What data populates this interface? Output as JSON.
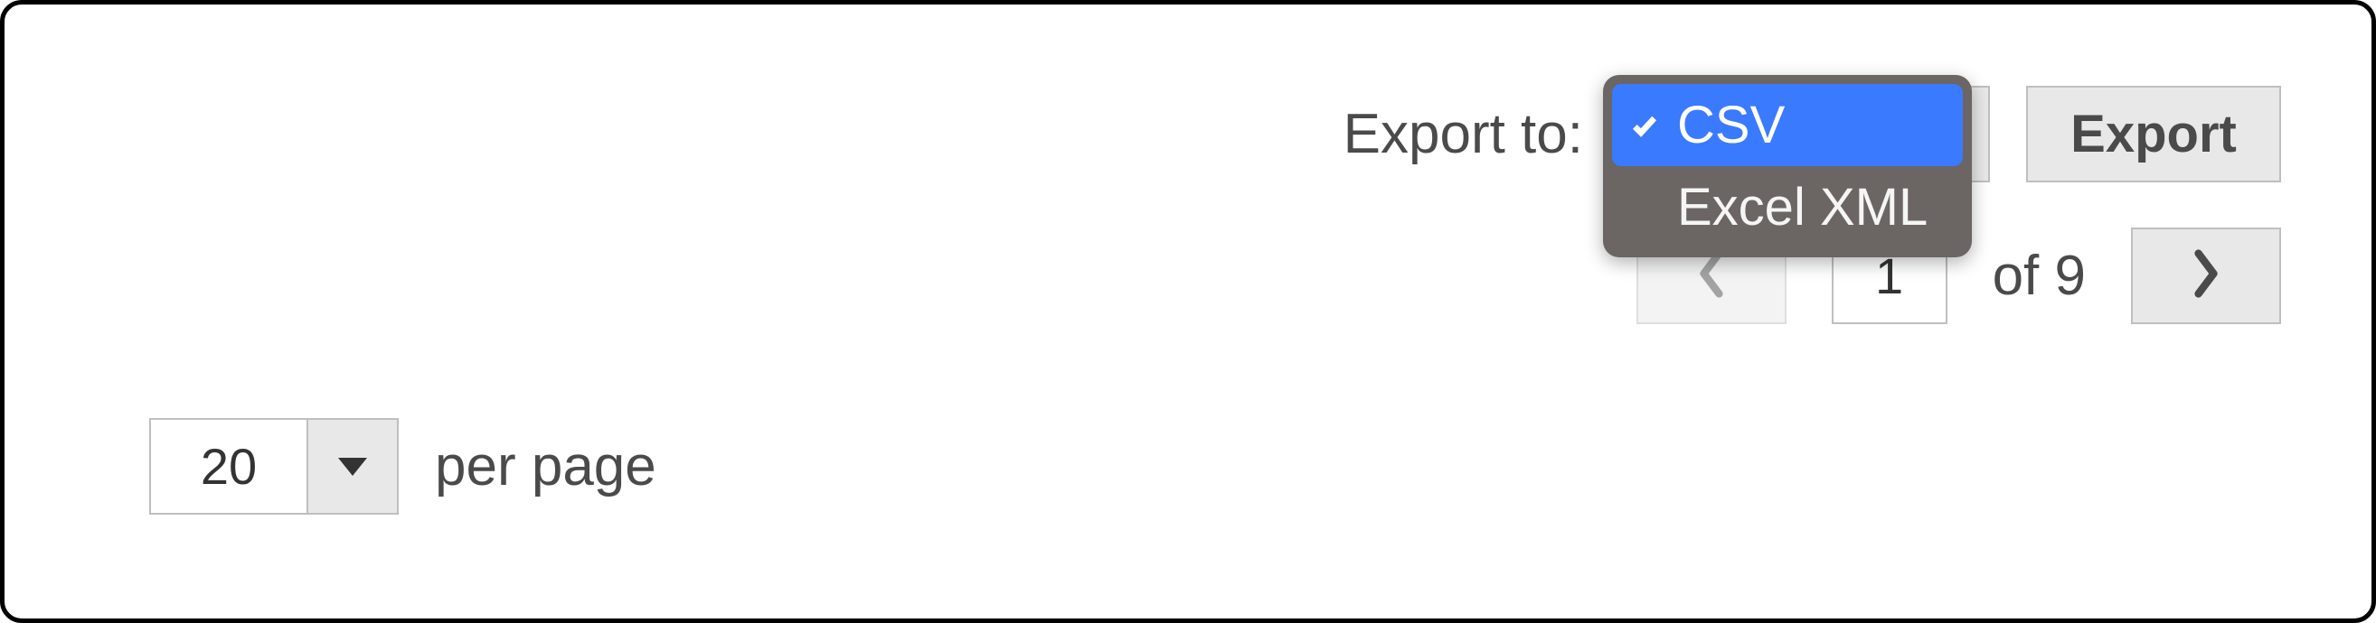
{
  "pagination": {
    "page_size": "20",
    "per_page_label": "per page",
    "current_page": "1",
    "of_label": "of 9"
  },
  "export": {
    "label": "Export to:",
    "button_label": "Export",
    "options": {
      "csv": "CSV",
      "excel_xml": "Excel XML"
    },
    "selected": "CSV"
  }
}
